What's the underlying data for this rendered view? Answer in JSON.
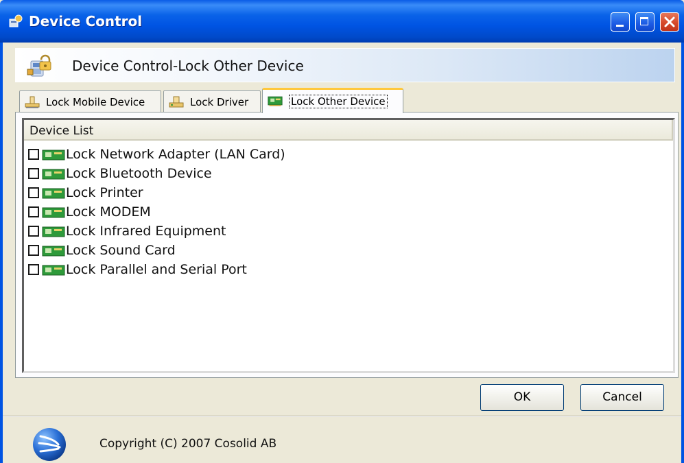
{
  "window": {
    "title": "Device Control",
    "title_icon": "gear-lock-icon",
    "controls": [
      "minimize-icon",
      "maximize-icon",
      "close-icon"
    ]
  },
  "banner": {
    "title": "Device Control-Lock Other Device",
    "icon": "device-lock-icon"
  },
  "tabs": [
    {
      "label": "Lock Mobile Device",
      "icon": "usb-drive-icon",
      "selected": false
    },
    {
      "label": "Lock Driver",
      "icon": "drive-icon",
      "selected": false
    },
    {
      "label": "Lock Other Device",
      "icon": "network-card-icon",
      "selected": true
    }
  ],
  "device_list": {
    "header": "Device List",
    "items": [
      {
        "label": "Lock Network Adapter (LAN Card)",
        "checked": false
      },
      {
        "label": "Lock Bluetooth Device",
        "checked": false
      },
      {
        "label": "Lock Printer",
        "checked": false
      },
      {
        "label": "Lock MODEM",
        "checked": false
      },
      {
        "label": "Lock Infrared Equipment",
        "checked": false
      },
      {
        "label": "Lock Sound Card",
        "checked": false
      },
      {
        "label": "Lock Parallel and Serial Port",
        "checked": false
      }
    ]
  },
  "buttons": {
    "ok": "OK",
    "cancel": "Cancel"
  },
  "footer": {
    "copyright": "Copyright (C) 2007 Cosolid AB",
    "logo": "cosolid-logo-icon"
  },
  "colors": {
    "titlebar": "#0054e3",
    "window_bg": "#ece9d8",
    "tab_highlight": "#ffc83c",
    "card_green": "#2e9a3a"
  }
}
